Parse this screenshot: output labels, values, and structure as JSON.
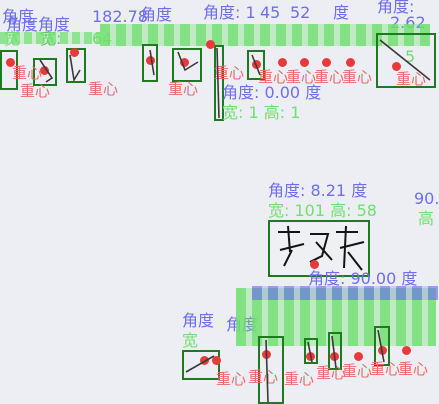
{
  "main_label": {
    "angle_text": "角度: 8.21 度",
    "angle_text_2": "90.",
    "size_text": "宽: 101 高: 58",
    "size_text_2": "高"
  },
  "mid_label": {
    "angle_text": "角度: 0.00 度",
    "size_text": "宽: 1 高: 1"
  },
  "right_label": {
    "angle_text": "角度: 90.00 度"
  },
  "top_texts": {
    "a1": "角度",
    "a2": "角度角度",
    "a3": "角度",
    "a4": "角度: 1",
    "a5": "角度:",
    "a6": "角度",
    "n1": "182.78",
    "n2": "45",
    "n3": "52",
    "n4": "度",
    "n5": "2.62",
    "w1": "宽",
    "w2": "64",
    "w3": "宽:",
    "w4": "5"
  },
  "centroid_label": "重心",
  "bottom_texts": {
    "a1": "角度",
    "a2": "角度",
    "w1": "宽"
  },
  "colors": {
    "angle": "#6e6ef0",
    "size": "#6fe06f",
    "centroid": "#f06a6a",
    "box": "#1e7a1e",
    "dot": "#e83a3a",
    "background": "#edeef3"
  }
}
